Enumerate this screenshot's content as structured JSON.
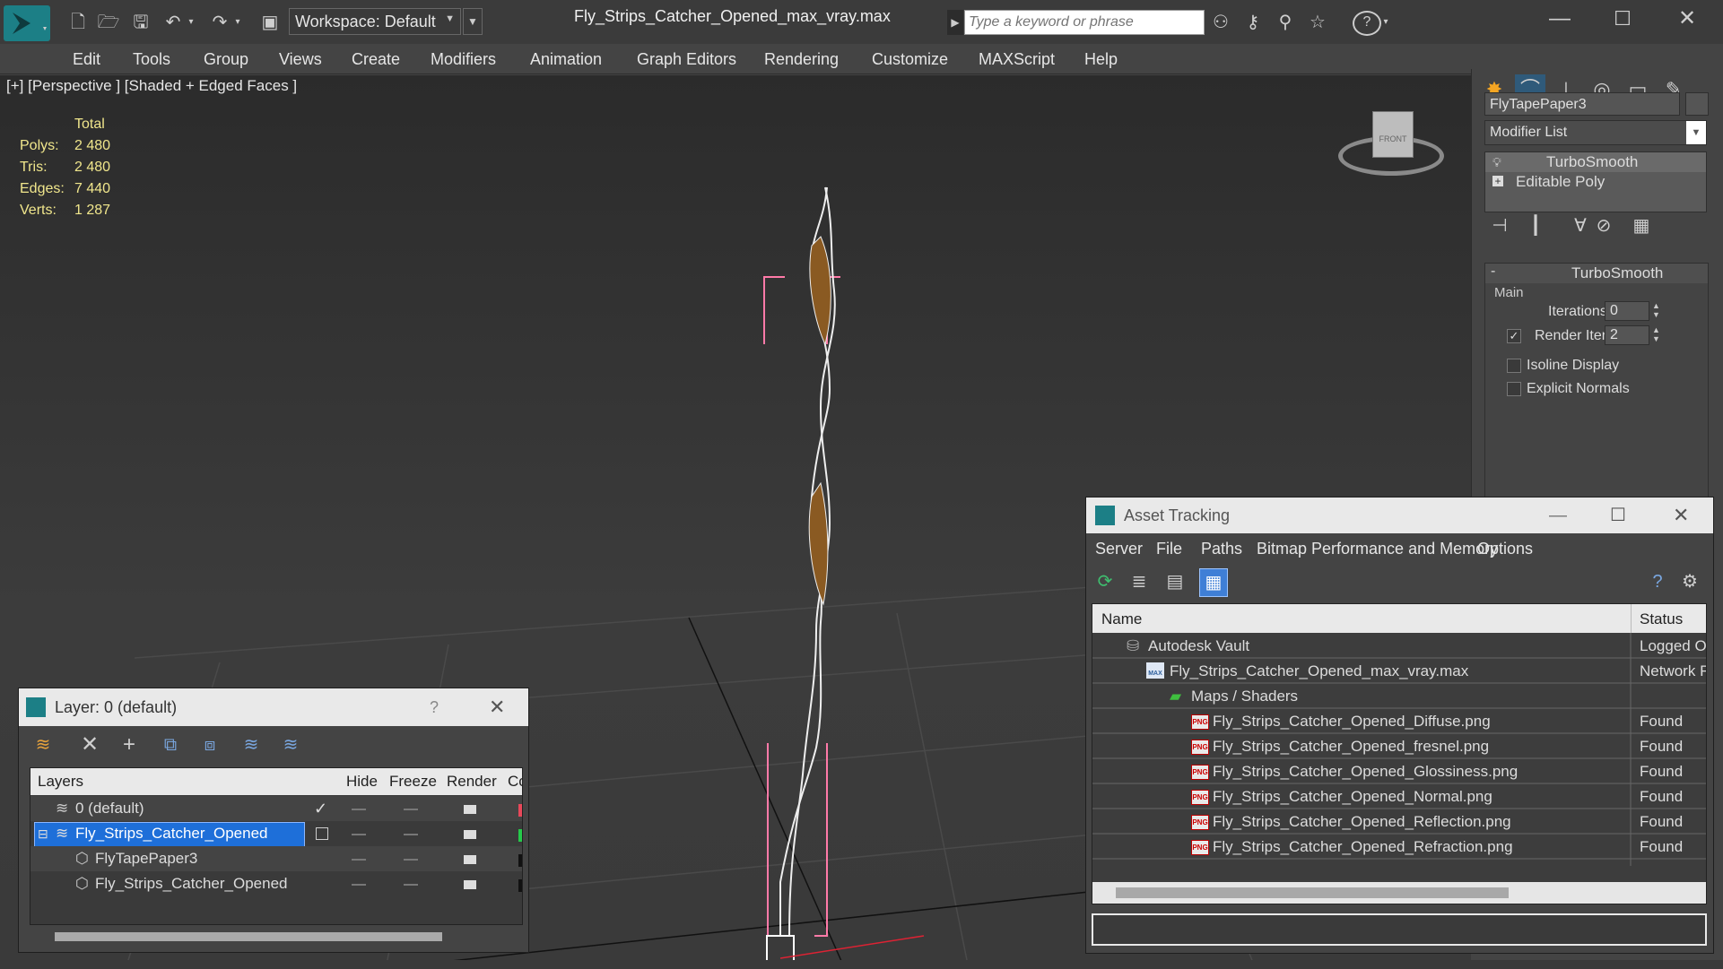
{
  "window": {
    "title": "Fly_Strips_Catcher_Opened_max_vray.max",
    "workspace": "Workspace: Default",
    "search_placeholder": "Type a keyword or phrase"
  },
  "menu": [
    "Edit",
    "Tools",
    "Group",
    "Views",
    "Create",
    "Modifiers",
    "Animation",
    "Graph Editors",
    "Rendering",
    "Customize",
    "MAXScript",
    "Help"
  ],
  "viewport": {
    "label": "[+] [Perspective ] [Shaded + Edged Faces ]",
    "stats": {
      "header": "Total",
      "rows": [
        {
          "label": "Polys:",
          "value": "2 480"
        },
        {
          "label": "Tris:",
          "value": "2 480"
        },
        {
          "label": "Edges:",
          "value": "7 440"
        },
        {
          "label": "Verts:",
          "value": "1 287"
        }
      ]
    },
    "viewcube_label": "FRONT"
  },
  "command_panel": {
    "object_name": "FlyTapePaper3",
    "modifier_list": "Modifier List",
    "stack": [
      "TurboSmooth",
      "Editable Poly"
    ],
    "rollout_title": "TurboSmooth",
    "group_main": "Main",
    "iterations_label": "Iterations:",
    "iterations_value": "0",
    "render_iters_label": "Render Iters:",
    "render_iters_value": "2",
    "isoline_label": "Isoline Display",
    "explicit_normals_label": "Explicit Normals",
    "collapse_symbol": "-"
  },
  "layer_window": {
    "title": "Layer: 0 (default)",
    "help": "?",
    "columns": [
      "Layers",
      "Hide",
      "Freeze",
      "Render",
      "Cc"
    ],
    "rows": [
      {
        "name": "0 (default)"
      },
      {
        "name": "Fly_Strips_Catcher_Opened"
      },
      {
        "name": "FlyTapePaper3"
      },
      {
        "name": "Fly_Strips_Catcher_Opened"
      }
    ]
  },
  "asset_window": {
    "title": "Asset Tracking",
    "menu": [
      "Server",
      "File",
      "Paths",
      "Bitmap Performance and Memory",
      "Options"
    ],
    "columns": [
      "Name",
      "Status"
    ],
    "png_tag": "PNG",
    "max_tag": "MAX",
    "rows": [
      {
        "name": "Autodesk Vault",
        "status": "Logged O"
      },
      {
        "name": "Fly_Strips_Catcher_Opened_max_vray.max",
        "status": "Network F"
      },
      {
        "name": "Maps / Shaders",
        "status": ""
      },
      {
        "name": "Fly_Strips_Catcher_Opened_Diffuse.png",
        "status": "Found"
      },
      {
        "name": "Fly_Strips_Catcher_Opened_fresnel.png",
        "status": "Found"
      },
      {
        "name": "Fly_Strips_Catcher_Opened_Glossiness.png",
        "status": "Found"
      },
      {
        "name": "Fly_Strips_Catcher_Opened_Normal.png",
        "status": "Found"
      },
      {
        "name": "Fly_Strips_Catcher_Opened_Reflection.png",
        "status": "Found"
      },
      {
        "name": "Fly_Strips_Catcher_Opened_Refraction.png",
        "status": "Found"
      }
    ]
  }
}
